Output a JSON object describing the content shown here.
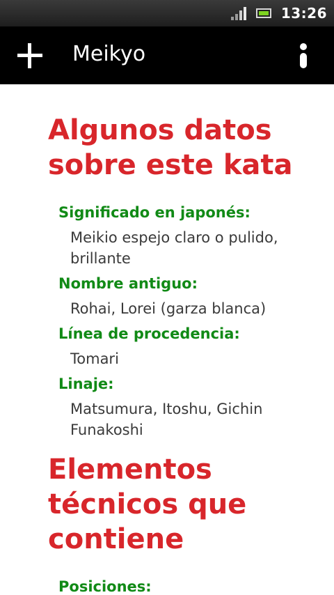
{
  "status_bar": {
    "time": "13:26",
    "signal_icon": "signal-strength-icon",
    "battery_icon": "battery-full-icon"
  },
  "action_bar": {
    "title": "Meikyo",
    "add_icon": "plus-icon",
    "info_icon": "info-icon"
  },
  "content": {
    "section_1": {
      "title": "Algunos datos sobre este kata",
      "fields": [
        {
          "label": "Significado en japonés:",
          "value": "Meikio espejo claro o pulido, brillante"
        },
        {
          "label": "Nombre antiguo:",
          "value": "Rohai, Lorei (garza blanca)"
        },
        {
          "label": "Línea de procedencia:",
          "value": "Tomari"
        },
        {
          "label": "Linaje:",
          "value": "Matsumura, Itoshu, Gichin Funakoshi"
        }
      ]
    },
    "section_2": {
      "title": "Elementos técnicos que contiene",
      "fields": [
        {
          "label": "Posiciones:",
          "value": ""
        }
      ]
    }
  },
  "colors": {
    "section_title": "#d8262b",
    "field_label": "#118a16",
    "field_value": "#3a3a3a",
    "action_bar": "#000000"
  }
}
